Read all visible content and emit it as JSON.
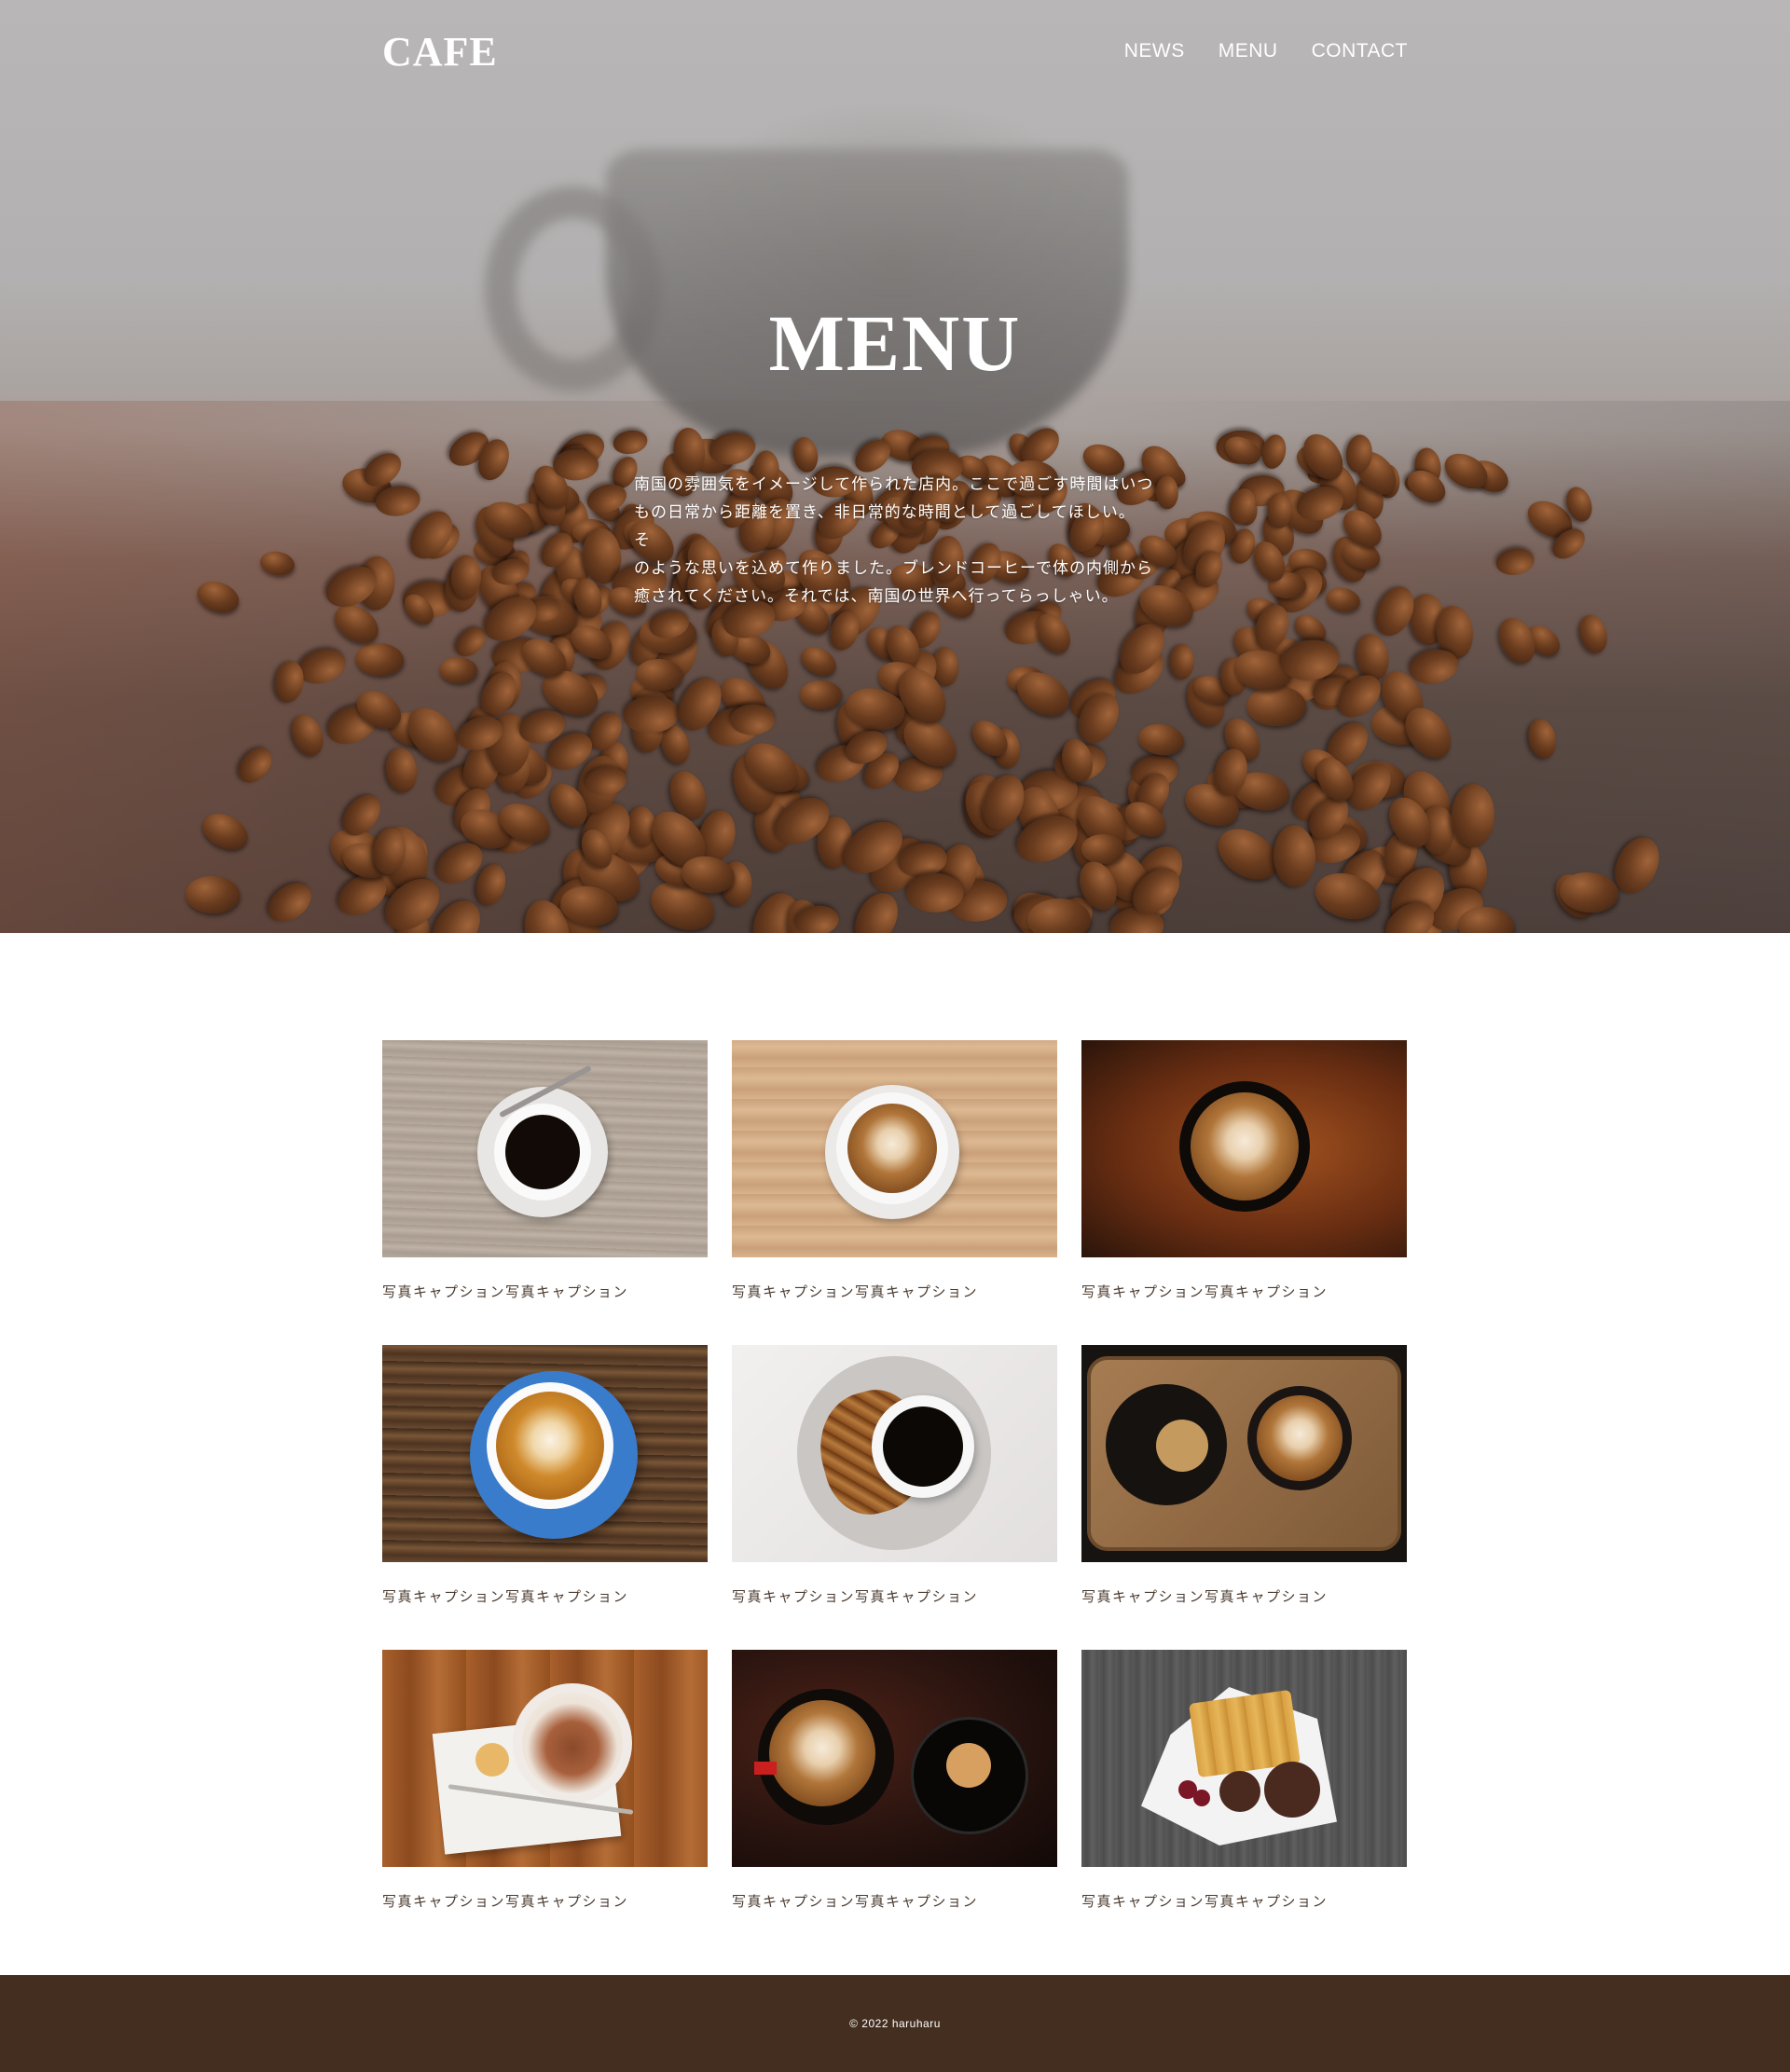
{
  "header": {
    "logo": "CAFE",
    "nav": [
      "NEWS",
      "MENU",
      "CONTACT"
    ]
  },
  "hero": {
    "title": "MENU",
    "lines": [
      "南国の雰囲気をイメージして作られた店内。ここで過ごす時間はいつ",
      "もの日常から距離を置き、非日常的な時間として過ごしてほしい。 そ",
      "のような思いを込めて作りました。ブレンドコーヒーで体の内側から",
      "癒されてください。それでは、南国の世界へ行ってらっしゃい。"
    ]
  },
  "gallery": {
    "items": [
      {
        "caption": "写真キャプション写真キャプション"
      },
      {
        "caption": "写真キャプション写真キャプション"
      },
      {
        "caption": "写真キャプション写真キャプション"
      },
      {
        "caption": "写真キャプション写真キャプション"
      },
      {
        "caption": "写真キャプション写真キャプション"
      },
      {
        "caption": "写真キャプション写真キャプション"
      },
      {
        "caption": "写真キャプション写真キャプション"
      },
      {
        "caption": "写真キャプション写真キャプション"
      },
      {
        "caption": "写真キャプション写真キャプション"
      }
    ]
  },
  "footer": {
    "copyright": "© 2022 haruharu"
  }
}
